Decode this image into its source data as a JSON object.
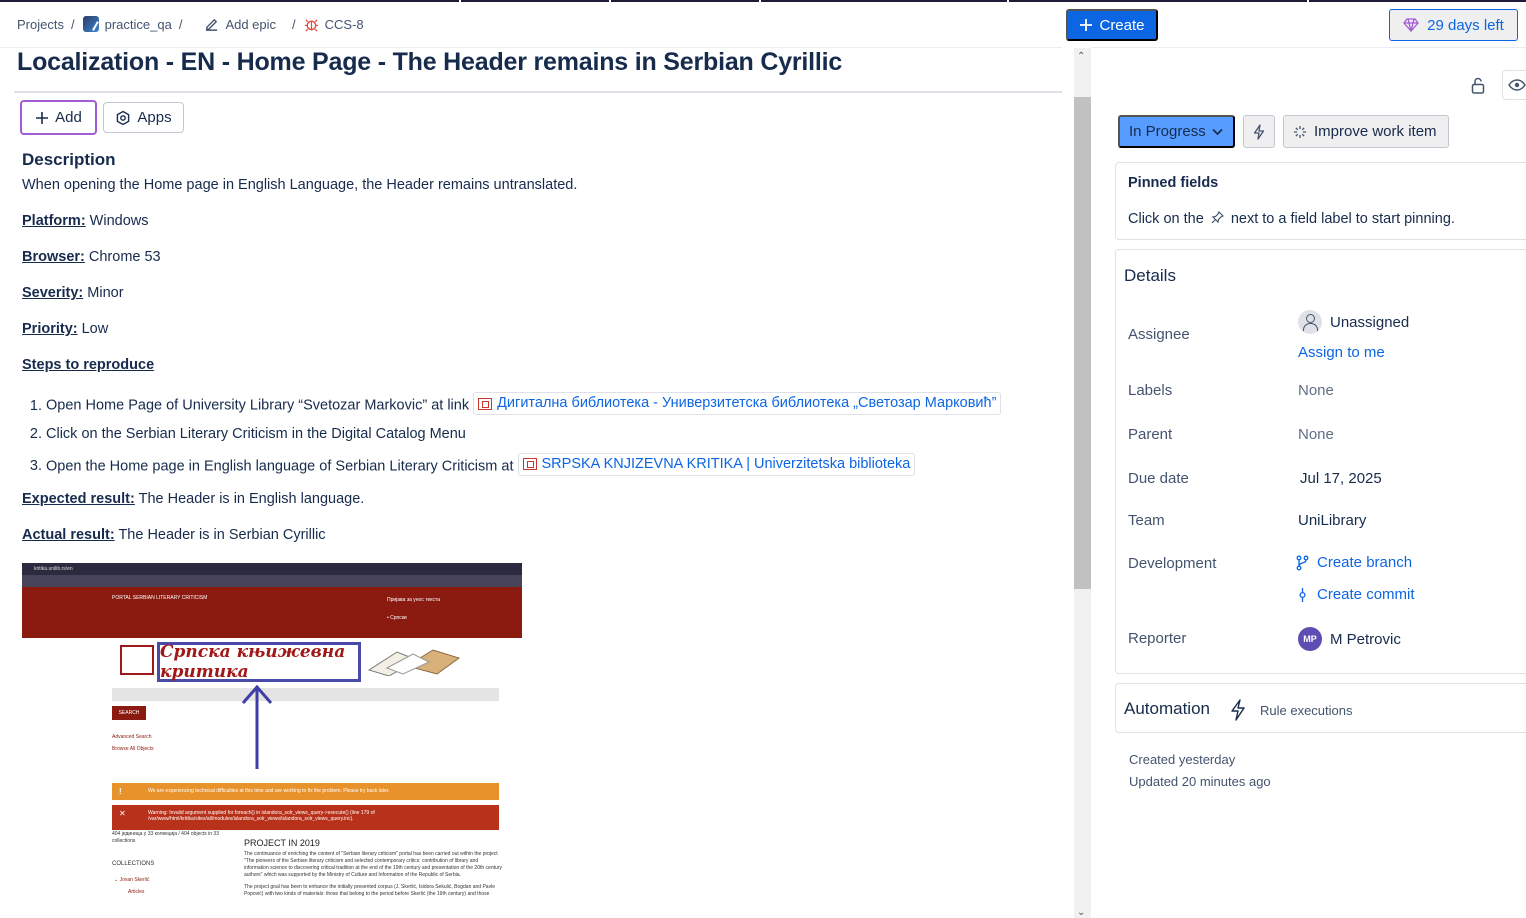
{
  "breadcrumb": {
    "projects": "Projects",
    "project": "practice_qa",
    "add_epic": "Add epic",
    "issue_key": "CCS-8",
    "separator": "/"
  },
  "issue": {
    "title": "Localization - EN - Home Page - The Header remains in Serbian Cyrillic"
  },
  "toolbar": {
    "add_label": "Add",
    "apps_label": "Apps"
  },
  "description": {
    "heading": "Description",
    "intro": "When opening the Home page in English Language, the Header remains untranslated.",
    "platform_label": "Platform:",
    "platform_value": " Windows",
    "browser_label": "Browser:",
    "browser_value": " Chrome 53",
    "severity_label": "Severity:",
    "severity_value": " Minor",
    "priority_label": "Priority:",
    "priority_value": " Low",
    "steps_label": "Steps to reproduce",
    "steps": [
      {
        "text": "Open Home Page of University Library “Svetozar Markovic” at link ",
        "link": "Дигитална библиотека - Универзитетска библиотека „Светозар Марковић”"
      },
      {
        "text": "Click on the Serbian Literary Criticism in the Digital Catalog Menu",
        "link": ""
      },
      {
        "text": "Open the Home page in English language of Serbian Literary Criticism at ",
        "link": "SRPSKA KNJIZEVNA KRITIKA | Univerzitetska biblioteka"
      }
    ],
    "expected_label": "Expected result:",
    "expected_value": " The Header is in English language.",
    "actual_label": "Actual result:",
    "actual_value": " The Header is in Serbian Cyrillic"
  },
  "attachment": {
    "url": "kritika.unilib.rs/en",
    "portal_title": "PORTAL SERBIAN LITERARY CRITICISM",
    "login": "Пријава за унос текста",
    "menu_item": "Српски",
    "logo_text": "Српска књижевна критика",
    "search": "SEARCH",
    "advanced": "Advanced Search",
    "browse": "Browse All Objects",
    "warn": "We are experiencing technical difficulties at this time and are working to fix the problem. Please try back later.",
    "err1": "Warning: Invalid argument supplied for foreach() in islandora_solr_views_query->execute() (line 179 of",
    "err2": "/var/www/html/kritika/sites/all/modules/islandora_solr_views/islandora_solr_views_query.inc).",
    "count": "404 јединица у 33 колекција / 404 objects in 33",
    "count2": "collections",
    "collections": "COLLECTIONS",
    "col1": "Jovan Skerlić",
    "col2": "Articles",
    "project_heading": "PROJECT IN 2019",
    "p1": "The continuance of enriching the content of \"Serbian literary criticism\" portal has been carried out within the",
    "p2": "project \"The pioneers of the Serbian literary criticism and selected contemporary critics: contribution of library and",
    "p3": "information science to discovering critical tradition at the end of the 19th century and presentation of the 20th",
    "p4": "century authors\" which was supported by the Ministry of Culture and Information of the Republic of Serbia.",
    "p5": "The project goal has been to enhance the initially presented corpus (J. Skerlić, Isidora Sekulić, Bogdan and Pavle",
    "p6": "Popović) with two kinds of materials: those that belong to the period before Skerlić (the 19th century) and those"
  },
  "header_actions": {
    "create_label": "Create",
    "trial_label": "29 days left"
  },
  "status": {
    "current": "In Progress",
    "improve_label": "Improve work item"
  },
  "pinned": {
    "heading": "Pinned fields",
    "hint_before": "Click on the",
    "hint_after": "next to a field label to start pinning."
  },
  "details": {
    "heading": "Details",
    "assignee_label": "Assignee",
    "assignee_value": "Unassigned",
    "assign_to_me": "Assign to me",
    "labels_label": "Labels",
    "labels_value": "None",
    "parent_label": "Parent",
    "parent_value": "None",
    "due_label": "Due date",
    "due_value": "Jul 17, 2025",
    "team_label": "Team",
    "team_value": "UniLibrary",
    "dev_label": "Development",
    "create_branch": "Create branch",
    "create_commit": "Create commit",
    "reporter_label": "Reporter",
    "reporter_initials": "MP",
    "reporter_name": "M Petrovic"
  },
  "automation": {
    "heading": "Automation",
    "rule_executions": "Rule executions"
  },
  "meta": {
    "created": "Created yesterday",
    "updated": "Updated 20 minutes ago"
  },
  "colors": {
    "primary": "#0c66e4",
    "status_in_progress": "#579dff",
    "add_outline": "#a35bd6",
    "reporter_avatar": "#5e4db2"
  }
}
